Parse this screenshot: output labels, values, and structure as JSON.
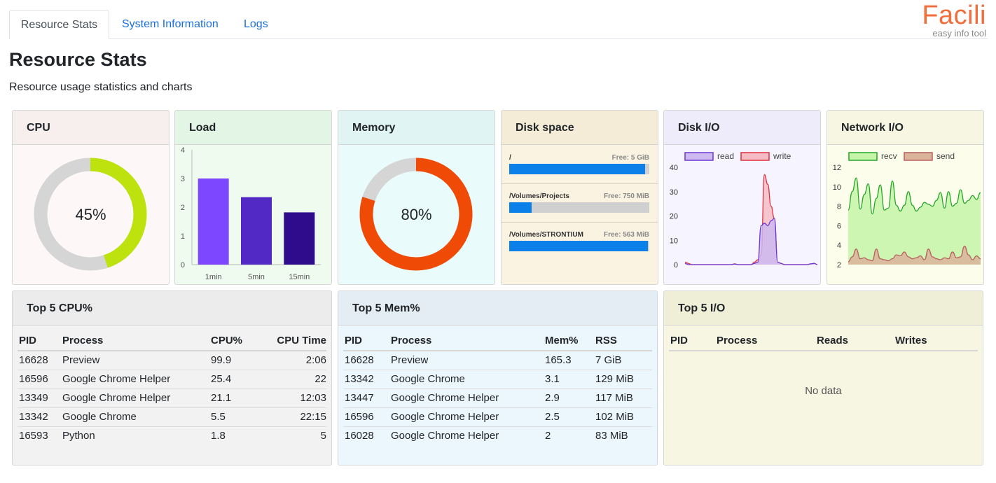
{
  "tabs": [
    "Resource Stats",
    "System Information",
    "Logs"
  ],
  "brand": {
    "name": "Facili",
    "tagline": "easy info tool"
  },
  "page": {
    "title": "Resource Stats",
    "subtitle": "Resource usage statistics and charts"
  },
  "colors": {
    "accent": "#1a6fe0",
    "brand": "#f36d3a"
  },
  "cpu": {
    "title": "CPU",
    "percent": 45,
    "label": "45%",
    "color": "#bde20e",
    "track": "#d5d5d5"
  },
  "load": {
    "title": "Load",
    "chart_data": {
      "type": "bar",
      "categories": [
        "1min",
        "5min",
        "15min"
      ],
      "values": [
        3.0,
        2.35,
        1.82
      ],
      "yticks": [
        "0",
        "1",
        "2",
        "3",
        "4"
      ],
      "ylim": [
        0,
        4
      ],
      "colors": [
        "#7d46ff",
        "#5329c6",
        "#2f0c8c"
      ]
    }
  },
  "memory": {
    "title": "Memory",
    "percent": 80,
    "label": "80%",
    "color": "#ef4a06",
    "track": "#d5d5d5"
  },
  "disk": {
    "title": "Disk space",
    "items": [
      {
        "name": "/",
        "free": "Free: 5 GiB",
        "used_fraction": 0.97
      },
      {
        "name": "/Volumes/Projects",
        "free": "Free: 750 MiB",
        "used_fraction": 0.16
      },
      {
        "name": "/Volumes/STRONTIUM",
        "free": "Free: 563 MiB",
        "used_fraction": 0.99
      }
    ]
  },
  "diskio": {
    "title": "Disk I/O",
    "chart_data": {
      "type": "area",
      "ylim": [
        0,
        40
      ],
      "yticks": [
        "0",
        "10",
        "20",
        "30",
        "40"
      ],
      "series": [
        {
          "name": "read",
          "color": "#6b3ad6",
          "fill": "#cdb9f0",
          "values": [
            0.5,
            0,
            0,
            0,
            0,
            0,
            0,
            0,
            0,
            0,
            0,
            0,
            0,
            0,
            0,
            0.2,
            0,
            0,
            0,
            0,
            0,
            0.5,
            1,
            16,
            17,
            16,
            18,
            19,
            1,
            0.5,
            0,
            0,
            0,
            0,
            0,
            0,
            0,
            0,
            0.3,
            0.5,
            0
          ]
        },
        {
          "name": "write",
          "color": "#e0303f",
          "fill": "#f6bcc4",
          "values": [
            1,
            0.5,
            0,
            0,
            0,
            0,
            0,
            0,
            0,
            0,
            0,
            0,
            0,
            0,
            0,
            0.3,
            0,
            0,
            0,
            0,
            0,
            1,
            2,
            4,
            37,
            33,
            24,
            19,
            1,
            0.5,
            0,
            0,
            0,
            0,
            0,
            0,
            0,
            0,
            0.3,
            0.5,
            0
          ]
        }
      ]
    }
  },
  "netio": {
    "title": "Network I/O",
    "chart_data": {
      "type": "area",
      "ylim": [
        2,
        12
      ],
      "yticks": [
        "2",
        "4",
        "6",
        "8",
        "10",
        "12"
      ],
      "series": [
        {
          "name": "recv",
          "color": "#25a62b",
          "fill": "#c4f5a8",
          "values": [
            7.6,
            9.5,
            10.9,
            7.7,
            9.2,
            10.3,
            7.2,
            8.8,
            10.2,
            7.6,
            7.8,
            10.6,
            8.1,
            7.5,
            8.1,
            9.5,
            8.1,
            7.5,
            7.9,
            8.4,
            8.2,
            8.0,
            8.6,
            9.4,
            7.8,
            9.5,
            8.0,
            8.3,
            9.7,
            8.3,
            8.6,
            9.1,
            8.7,
            9.4
          ]
        },
        {
          "name": "send",
          "color": "#b85e5e",
          "fill": "#d9b39a",
          "values": [
            2.3,
            2.8,
            3.6,
            2.6,
            2.7,
            2.5,
            2.4,
            3.6,
            2.6,
            2.5,
            2.4,
            2.6,
            3.0,
            2.9,
            3.3,
            2.8,
            2.6,
            2.7,
            2.9,
            2.5,
            3.6,
            2.8,
            2.6,
            2.5,
            2.7,
            2.6,
            3.3,
            2.7,
            2.8,
            3.9,
            3.0,
            2.5,
            2.9,
            2.6
          ]
        }
      ]
    }
  },
  "topcpu": {
    "title": "Top 5 CPU%",
    "headers": [
      "PID",
      "Process",
      "CPU%",
      "CPU Time"
    ],
    "rows": [
      [
        "16628",
        "Preview",
        "99.9",
        "2:06"
      ],
      [
        "16596",
        "Google Chrome Helper",
        "25.4",
        "22"
      ],
      [
        "13349",
        "Google Chrome Helper",
        "21.1",
        "12:03"
      ],
      [
        "13342",
        "Google Chrome",
        "5.5",
        "22:15"
      ],
      [
        "16593",
        "Python",
        "1.8",
        "5"
      ]
    ]
  },
  "topmem": {
    "title": "Top 5 Mem%",
    "headers": [
      "PID",
      "Process",
      "Mem%",
      "RSS"
    ],
    "rows": [
      [
        "16628",
        "Preview",
        "165.3",
        "7 GiB"
      ],
      [
        "13342",
        "Google Chrome",
        "3.1",
        "129 MiB"
      ],
      [
        "13447",
        "Google Chrome Helper",
        "2.9",
        "117 MiB"
      ],
      [
        "16596",
        "Google Chrome Helper",
        "2.5",
        "102 MiB"
      ],
      [
        "16028",
        "Google Chrome Helper",
        "2",
        "83 MiB"
      ]
    ]
  },
  "topio": {
    "title": "Top 5 I/O",
    "headers": [
      "PID",
      "Process",
      "Reads",
      "Writes"
    ],
    "empty": "No data"
  }
}
